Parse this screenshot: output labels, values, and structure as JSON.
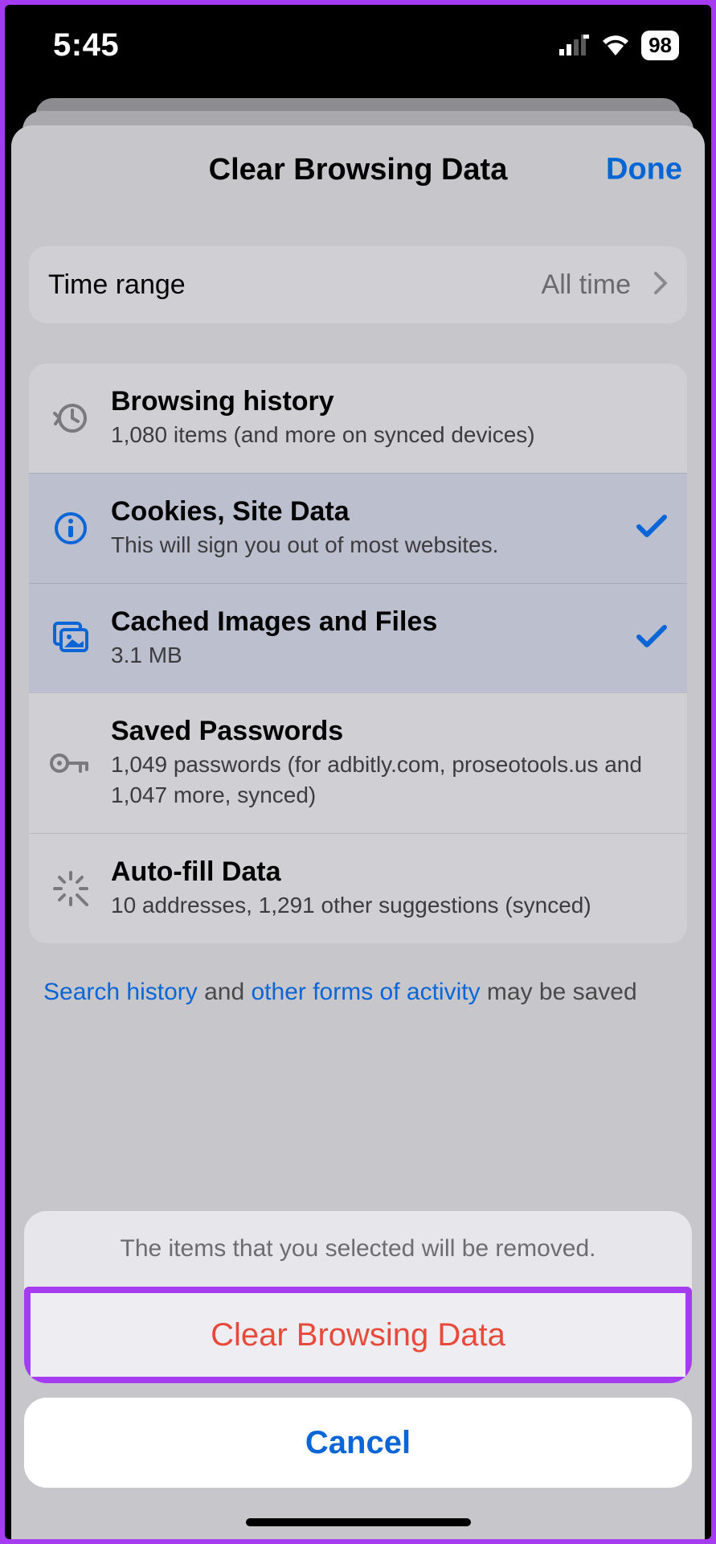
{
  "status": {
    "time": "5:45",
    "battery": "98"
  },
  "sheet": {
    "title": "Clear Browsing Data",
    "done": "Done"
  },
  "time_range": {
    "label": "Time range",
    "value": "All time"
  },
  "items": [
    {
      "key": "history",
      "icon": "history-icon",
      "title": "Browsing history",
      "subtitle": "1,080 items (and more on synced devices)",
      "selected": false
    },
    {
      "key": "cookies",
      "icon": "info-icon",
      "title": "Cookies, Site Data",
      "subtitle": "This will sign you out of most websites.",
      "selected": true
    },
    {
      "key": "cache",
      "icon": "images-icon",
      "title": "Cached Images and Files",
      "subtitle": "3.1 MB",
      "selected": true
    },
    {
      "key": "passwords",
      "icon": "key-icon",
      "title": "Saved Passwords",
      "subtitle": "1,049 passwords (for adbitly.com, proseotools.us and 1,047 more, synced)",
      "selected": false
    },
    {
      "key": "autofill",
      "icon": "wand-icon",
      "title": "Auto-fill Data",
      "subtitle": "10 addresses, 1,291 other suggestions (synced)",
      "selected": false
    }
  ],
  "footer": {
    "link1": "Search history",
    "text1": " and ",
    "link2": "other forms of activity",
    "text2": " may be saved"
  },
  "action_sheet": {
    "message": "The items that you selected will be removed.",
    "confirm": "Clear Browsing Data",
    "cancel": "Cancel"
  }
}
